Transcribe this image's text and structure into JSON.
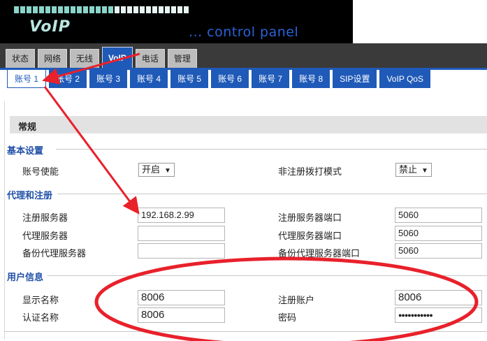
{
  "banner": {
    "logo": "VoIP",
    "subtitle": "... control panel"
  },
  "top_tabs": [
    "状态",
    "网络",
    "无线",
    "VoIP",
    "电话",
    "管理"
  ],
  "sub_tabs": [
    "账号 1",
    "账号 2",
    "账号 3",
    "账号 4",
    "账号 5",
    "账号 6",
    "账号 7",
    "账号 8",
    "SIP设置",
    "VoIP QoS"
  ],
  "section_title": "常规",
  "basic": {
    "legend": "基本设置",
    "account_enable_label": "账号使能",
    "account_enable_value": "开启",
    "unreg_dial_label": "非注册拨打模式",
    "unreg_dial_value": "禁止"
  },
  "proxy": {
    "legend": "代理和注册",
    "reg_server_label": "注册服务器",
    "reg_server_value": "192.168.2.99",
    "reg_port_label": "注册服务器端口",
    "reg_port_value": "5060",
    "proxy_server_label": "代理服务器",
    "proxy_server_value": "",
    "proxy_port_label": "代理服务器端口",
    "proxy_port_value": "5060",
    "backup_proxy_label": "备份代理服务器",
    "backup_proxy_value": "",
    "backup_port_label": "备份代理服务器端口",
    "backup_port_value": "5060"
  },
  "user": {
    "legend": "用户信息",
    "display_name_label": "显示名称",
    "display_name_value": "8006",
    "reg_account_label": "注册账户",
    "reg_account_value": "8006",
    "auth_name_label": "认证名称",
    "auth_name_value": "8006",
    "password_label": "密码",
    "password_value": "●●●●●●●●●●●"
  },
  "colors": {
    "tab_blue": "#1f5ab8",
    "annotation_red": "#e8212b"
  }
}
